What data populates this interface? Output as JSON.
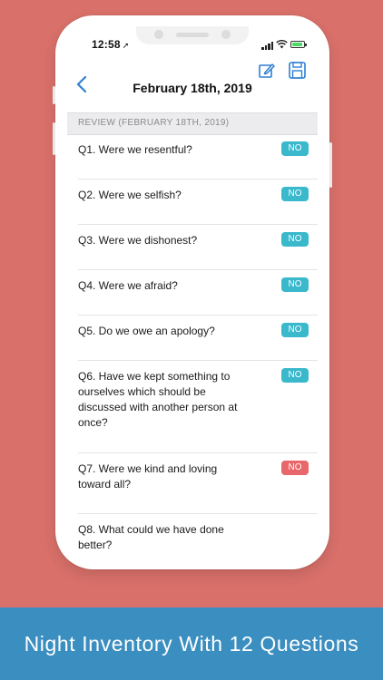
{
  "status_bar": {
    "time": "12:58"
  },
  "nav": {
    "title": "February 18th, 2019"
  },
  "section_header": "REVIEW (FEBRUARY 18TH, 2019)",
  "questions": [
    {
      "text": "Q1. Were we resentful?",
      "answer": "NO",
      "color": "#3ab8cc"
    },
    {
      "text": "Q2. Were we selfish?",
      "answer": "NO",
      "color": "#3ab8cc"
    },
    {
      "text": "Q3. Were we dishonest?",
      "answer": "NO",
      "color": "#3ab8cc"
    },
    {
      "text": "Q4. Were we afraid?",
      "answer": "NO",
      "color": "#3ab8cc"
    },
    {
      "text": "Q5. Do we owe an apology?",
      "answer": "NO",
      "color": "#3ab8cc"
    },
    {
      "text": "Q6. Have we kept something to ourselves which should be discussed with another person at once?",
      "answer": "NO",
      "color": "#3ab8cc"
    },
    {
      "text": "Q7. Were we kind and loving toward all?",
      "answer": "NO",
      "color": "#e8676a"
    },
    {
      "text": "Q8. What could we have done better?",
      "answer": "",
      "color": ""
    }
  ],
  "banner": {
    "text": "Night Inventory With 12 Questions"
  },
  "colors": {
    "accent": "#2f7fd4",
    "background": "#d9706a",
    "banner": "#3b8ec0"
  }
}
